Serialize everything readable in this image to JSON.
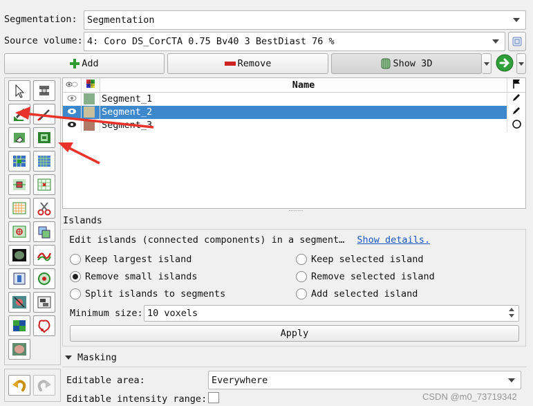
{
  "segmentation": {
    "label": "Segmentation:",
    "value": "Segmentation"
  },
  "source_volume": {
    "label": "Source volume:",
    "value": "4: Coro  DS_CorCTA  0.75  Bv40  3  BestDiast 76 %"
  },
  "toolbar": {
    "add_label": "Add",
    "remove_label": "Remove",
    "show3d_label": "Show 3D"
  },
  "segments_table": {
    "name_header": "Name",
    "rows": [
      {
        "name": "Segment_1",
        "color": "#85b08a",
        "visible": false,
        "selected": false,
        "status": "pencil"
      },
      {
        "name": "Segment_2",
        "color": "#c8c09a",
        "visible": true,
        "selected": true,
        "status": "pencil"
      },
      {
        "name": "Segment_3",
        "color": "#b07a66",
        "visible": true,
        "selected": false,
        "status": "circle"
      }
    ]
  },
  "effect_tools": [
    "cursor-tool-icon",
    "slice-threshold-icon",
    "paint-icon",
    "draw-icon",
    "erase-icon",
    "level-tracing-icon",
    "grow-from-seeds-icon",
    "fill-between-slices-icon",
    "threshold-icon",
    "margin-icon",
    "hollow-icon",
    "scissors-icon",
    "islands-icon",
    "logical-operators-icon",
    "smoothing-icon",
    "surface-cut-icon",
    "mask-volume-icon",
    "local-threshold-icon",
    "wrap-solidify-icon",
    "split-volume-icon",
    "engrave-icon",
    "draw-tube-icon",
    "watershed-icon"
  ],
  "undo_redo": [
    "undo-icon",
    "redo-icon"
  ],
  "islands": {
    "title": "Islands",
    "description": "Edit islands (connected components) in a segment…",
    "show_details": "Show details.",
    "options": [
      {
        "label": "Keep largest island",
        "checked": false
      },
      {
        "label": "Keep selected island",
        "checked": false
      },
      {
        "label": "Remove small islands",
        "checked": true
      },
      {
        "label": "Remove selected island",
        "checked": false
      },
      {
        "label": "Split islands to segments",
        "checked": false
      },
      {
        "label": "Add selected island",
        "checked": false
      }
    ],
    "min_size_label": "Minimum size:",
    "min_size_value": "10 voxels",
    "apply_label": "Apply"
  },
  "masking": {
    "title": "Masking",
    "editable_area_label": "Editable area:",
    "editable_area_value": "Everywhere",
    "editable_intensity_label": "Editable intensity range:"
  },
  "watermark": "CSDN @m0_73719342",
  "colors": {
    "selection": "#3d87cc",
    "annotation_arrow": "#e8332a",
    "add_plus": "#2f9a2f",
    "remove_minus": "#cc2222"
  }
}
